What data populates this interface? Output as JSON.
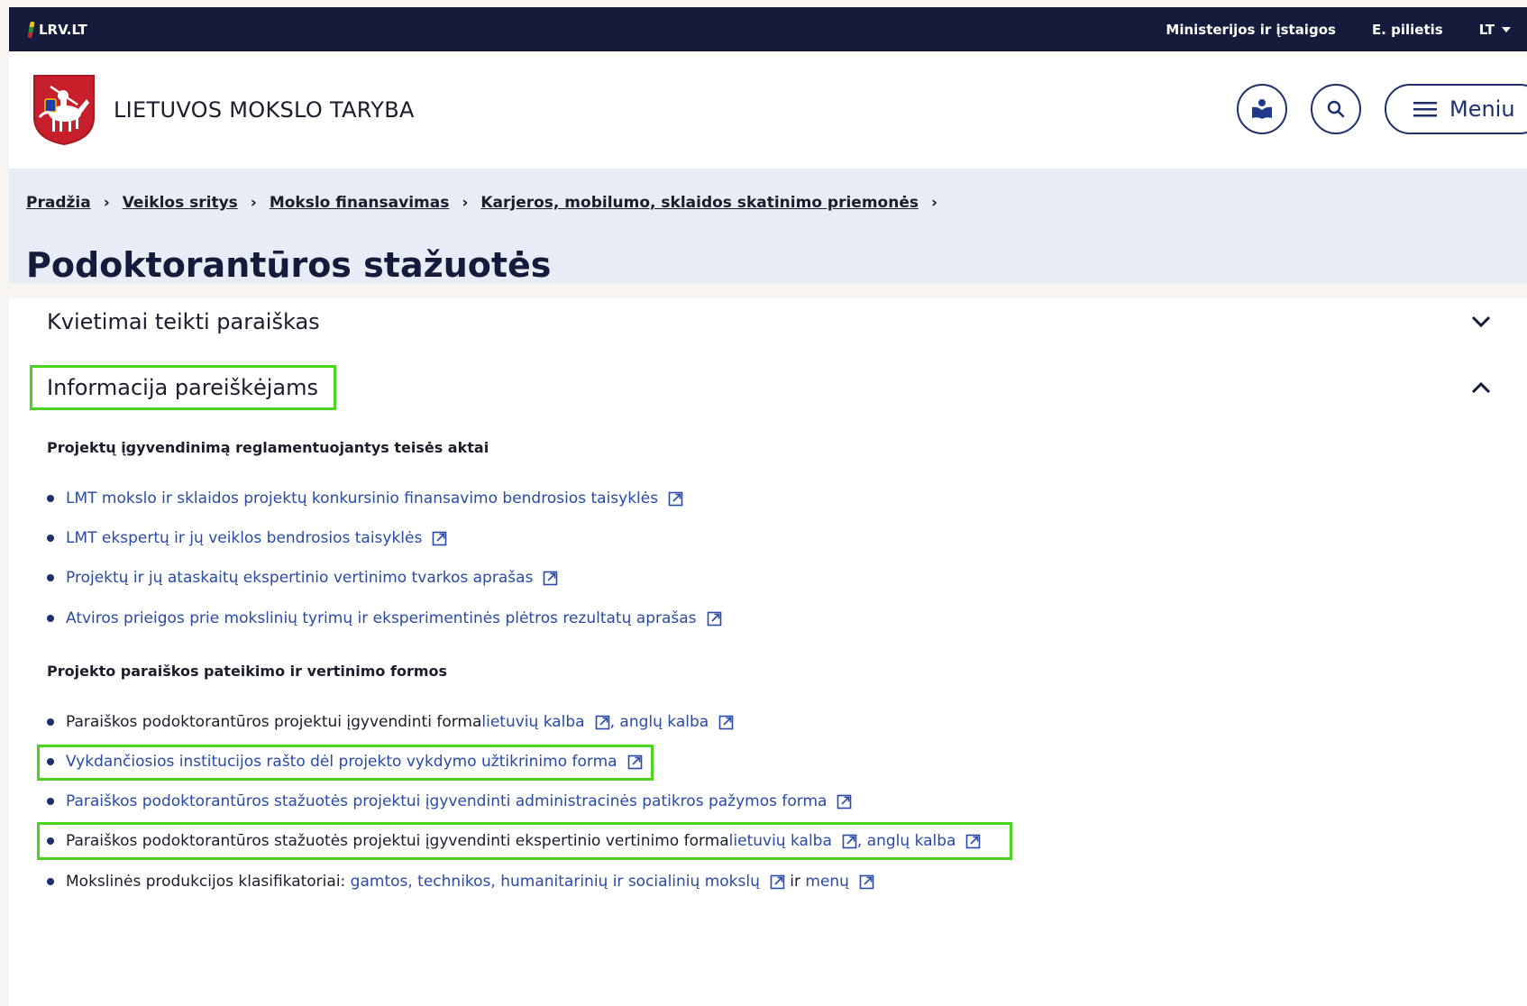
{
  "topbar": {
    "brand": "LRV.LT",
    "links": [
      "Ministerijos ir įstaigos",
      "E. pilietis"
    ],
    "language": "LT"
  },
  "header": {
    "org_name": "LIETUVOS MOKSLO TARYBA",
    "menu_label": "Meniu",
    "icons": [
      "coat-of-arms-logo",
      "reader-icon",
      "search-icon",
      "hamburger-icon"
    ]
  },
  "breadcrumbs": [
    "Pradžia",
    "Veiklos sritys",
    "Mokslo finansavimas",
    "Karjeros, mobilumo, sklaidos skatinimo priemonės"
  ],
  "page_title": "Podoktorantūros stažuotės",
  "accordions": [
    {
      "title": "Kvietimai teikti paraiškas",
      "state": "collapsed"
    },
    {
      "title": "Informacija pareiškėjams",
      "state": "expanded"
    }
  ],
  "section1": {
    "heading": "Projektų įgyvendinimą reglamentuojantys teisės aktai",
    "items": [
      "LMT mokslo ir sklaidos projektų konkursinio finansavimo bendrosios taisyklės",
      "LMT ekspertų ir jų veiklos bendrosios taisyklės",
      "Projektų ir jų ataskaitų ekspertinio vertinimo tvarkos aprašas",
      "Atviros prieigos prie mokslinių tyrimų ir eksperimentinės plėtros rezultatų aprašas"
    ]
  },
  "section2": {
    "heading": "Projekto paraiškos pateikimo ir vertinimo formos",
    "item1": {
      "text": "Paraiškos podoktorantūros projektui įgyvendinti forma ",
      "link1": "lietuvių kalba",
      "comma": ", ",
      "link2": "anglų kalba"
    },
    "item2": "Vykdančiosios institucijos rašto dėl projekto vykdymo užtikrinimo forma",
    "item3": "Paraiškos podoktorantūros stažuotės projektui įgyvendinti administracinės patikros pažymos forma",
    "item4": {
      "text": "Paraiškos podoktorantūros stažuotės projektui įgyvendinti ekspertinio vertinimo forma ",
      "link1": "lietuvių kalba",
      "comma": ", ",
      "link2": "anglų kalba"
    },
    "item5": {
      "text": "Mokslinės produkcijos klasifikatoriai: ",
      "link1": "gamtos, technikos, humanitarinių ir socialinių mokslų",
      "mid": " ir ",
      "link2": "menų"
    }
  },
  "colors": {
    "topbar": "#151b3a",
    "band": "#e8ecf6",
    "link": "#2a4aa6",
    "highlight": "#4cd31f"
  }
}
